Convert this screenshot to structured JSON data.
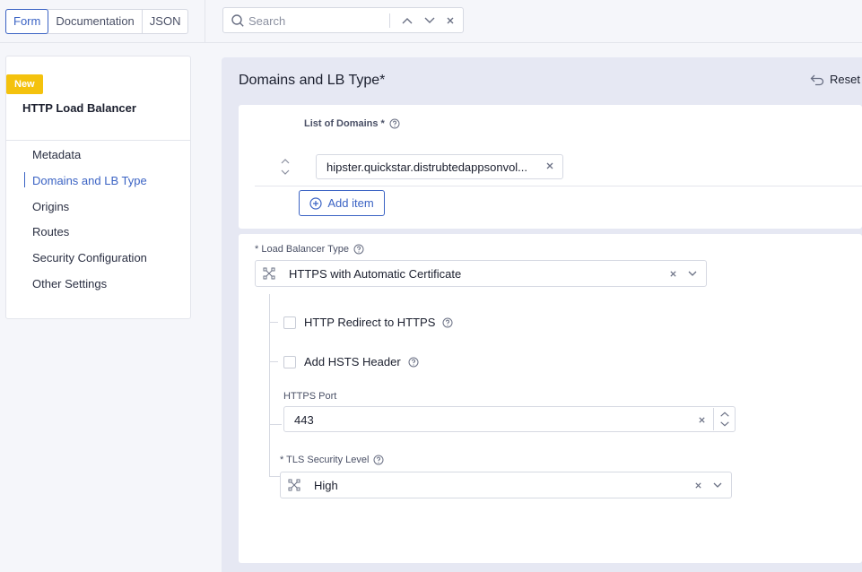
{
  "tabs": [
    {
      "label": "Form",
      "active": true
    },
    {
      "label": "Documentation",
      "active": false
    },
    {
      "label": "JSON",
      "active": false
    }
  ],
  "search": {
    "placeholder": "Search"
  },
  "sidebar": {
    "badge": "New",
    "title": "HTTP Load Balancer",
    "items": [
      {
        "label": "Metadata",
        "active": false
      },
      {
        "label": "Domains and LB Type",
        "active": true
      },
      {
        "label": "Origins",
        "active": false
      },
      {
        "label": "Routes",
        "active": false
      },
      {
        "label": "Security Configuration",
        "active": false
      },
      {
        "label": "Other Settings",
        "active": false
      }
    ]
  },
  "section": {
    "title": "Domains and LB Type",
    "required_mark": "*",
    "reset_label": "Reset"
  },
  "domains": {
    "label": "List of Domains *",
    "items": [
      "hipster.quickstar.distrubtedappsonvol..."
    ],
    "add_item_label": "Add item"
  },
  "lb_type": {
    "label": "* Load Balancer Type",
    "value": "HTTPS with Automatic Certificate",
    "http_redirect_label": "HTTP Redirect to HTTPS",
    "http_redirect_checked": false,
    "hsts_label": "Add HSTS Header",
    "hsts_checked": false,
    "https_port_label": "HTTPS Port",
    "https_port_value": "443",
    "tls_label": "* TLS Security Level",
    "tls_value": "High"
  },
  "colors": {
    "accent": "#3b63c4",
    "badge": "#f4c20d"
  }
}
